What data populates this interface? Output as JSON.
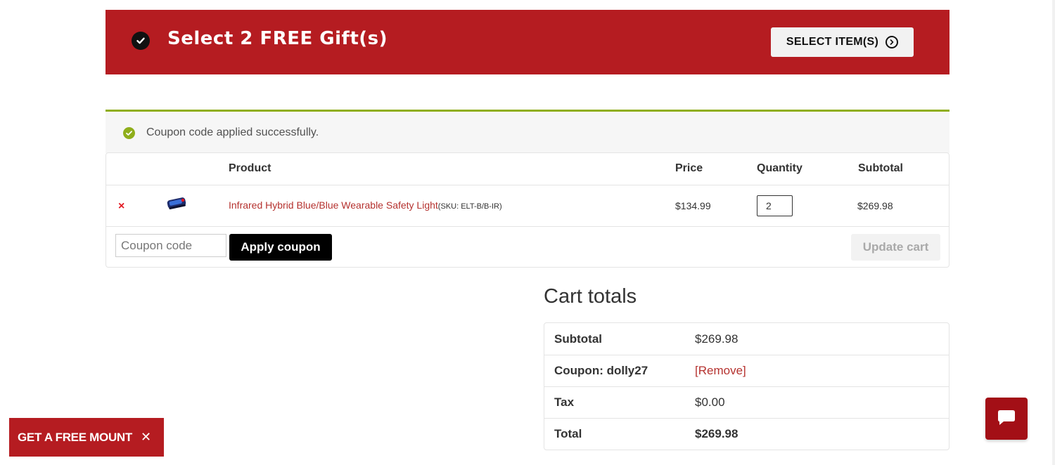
{
  "gift_banner": {
    "title": "Select 2 FREE Gift(s)",
    "select_button_label": "SELECT ITEM(S)",
    "background_color": "#b51c21"
  },
  "notice": {
    "message": "Coupon code applied successfully.",
    "accent_color": "#8fae1b"
  },
  "cart": {
    "headers": {
      "product": "Product",
      "price": "Price",
      "quantity": "Quantity",
      "subtotal": "Subtotal"
    },
    "items": [
      {
        "name": "Infrared Hybrid Blue/Blue Wearable Safety Light",
        "sku_text": "(SKU: ELT-B/B-IR)",
        "price": "$134.99",
        "quantity": "2",
        "subtotal": "$269.98",
        "remove_symbol": "×"
      }
    ],
    "coupon_placeholder": "Coupon code",
    "apply_coupon_label": "Apply coupon",
    "update_cart_label": "Update cart"
  },
  "totals": {
    "heading": "Cart totals",
    "subtotal_label": "Subtotal",
    "subtotal_value": "$269.98",
    "coupon_label": "Coupon: dolly27",
    "coupon_remove": "[Remove]",
    "tax_label": "Tax",
    "tax_value": "$0.00",
    "total_label": "Total",
    "total_value": "$269.98"
  },
  "promo_tab": {
    "label": "GET A FREE MOUNT",
    "close_symbol": "✕"
  },
  "icons": {
    "banner_check": "check-circle-icon",
    "select_arrow": "arrow-right-circle-icon",
    "notice_check": "check-circle-icon",
    "chat": "chat-bubble-icon"
  }
}
